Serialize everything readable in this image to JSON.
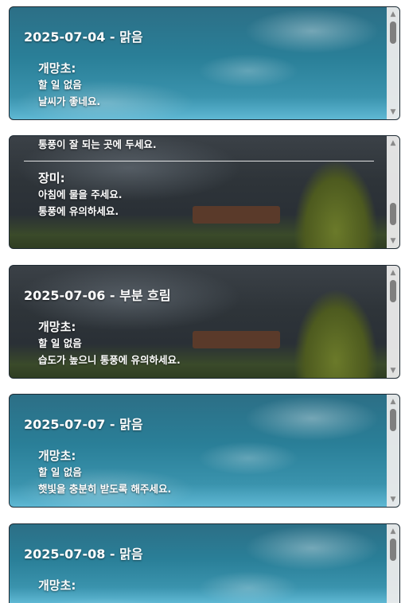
{
  "cards": [
    {
      "title": "2025-07-04 - 맑음",
      "plant": "개망초:",
      "lines": [
        "할 일 없음",
        "날씨가 좋네요."
      ]
    },
    {
      "top_line": "통풍이 잘 되는 곳에 두세요.",
      "plant": "장미:",
      "lines": [
        "아침에 물을 주세요.",
        "통풍에 유의하세요."
      ]
    },
    {
      "title": "2025-07-06 - 부분 흐림",
      "plant": "개망초:",
      "lines": [
        "할 일 없음",
        "습도가 높으니 통풍에 유의하세요."
      ]
    },
    {
      "title": "2025-07-07 - 맑음",
      "plant": "개망초:",
      "lines": [
        "할 일 없음",
        "햇빛을 충분히 받도록 해주세요."
      ]
    },
    {
      "title": "2025-07-08 - 맑음",
      "plant": "개망초:"
    }
  ],
  "icons": {
    "scroll_up": "triangle-up-icon",
    "scroll_down": "triangle-down-icon"
  }
}
